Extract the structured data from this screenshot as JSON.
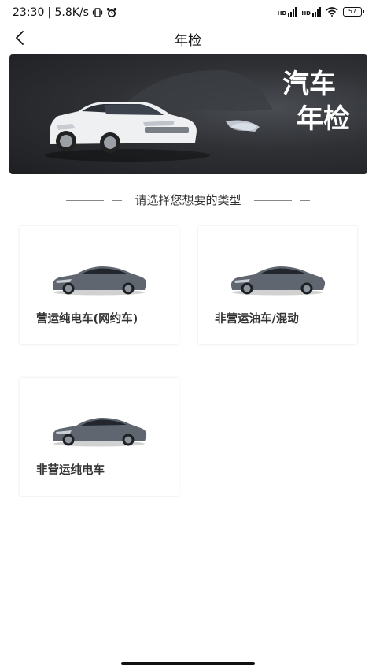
{
  "status_bar": {
    "time": "23:30",
    "speed": "5.8K/s",
    "signal1_label": "HD",
    "signal2_label": "HD",
    "battery": "57"
  },
  "header": {
    "title": "年检",
    "back_icon": "chevron-left-icon"
  },
  "banner": {
    "line1": "汽车",
    "line2": "年检"
  },
  "section": {
    "heading": "请选择您想要的类型"
  },
  "cards": [
    {
      "label": "营运纯电车(网约车)"
    },
    {
      "label": "非营运油车/混动"
    },
    {
      "label": "非营运纯电车"
    }
  ]
}
